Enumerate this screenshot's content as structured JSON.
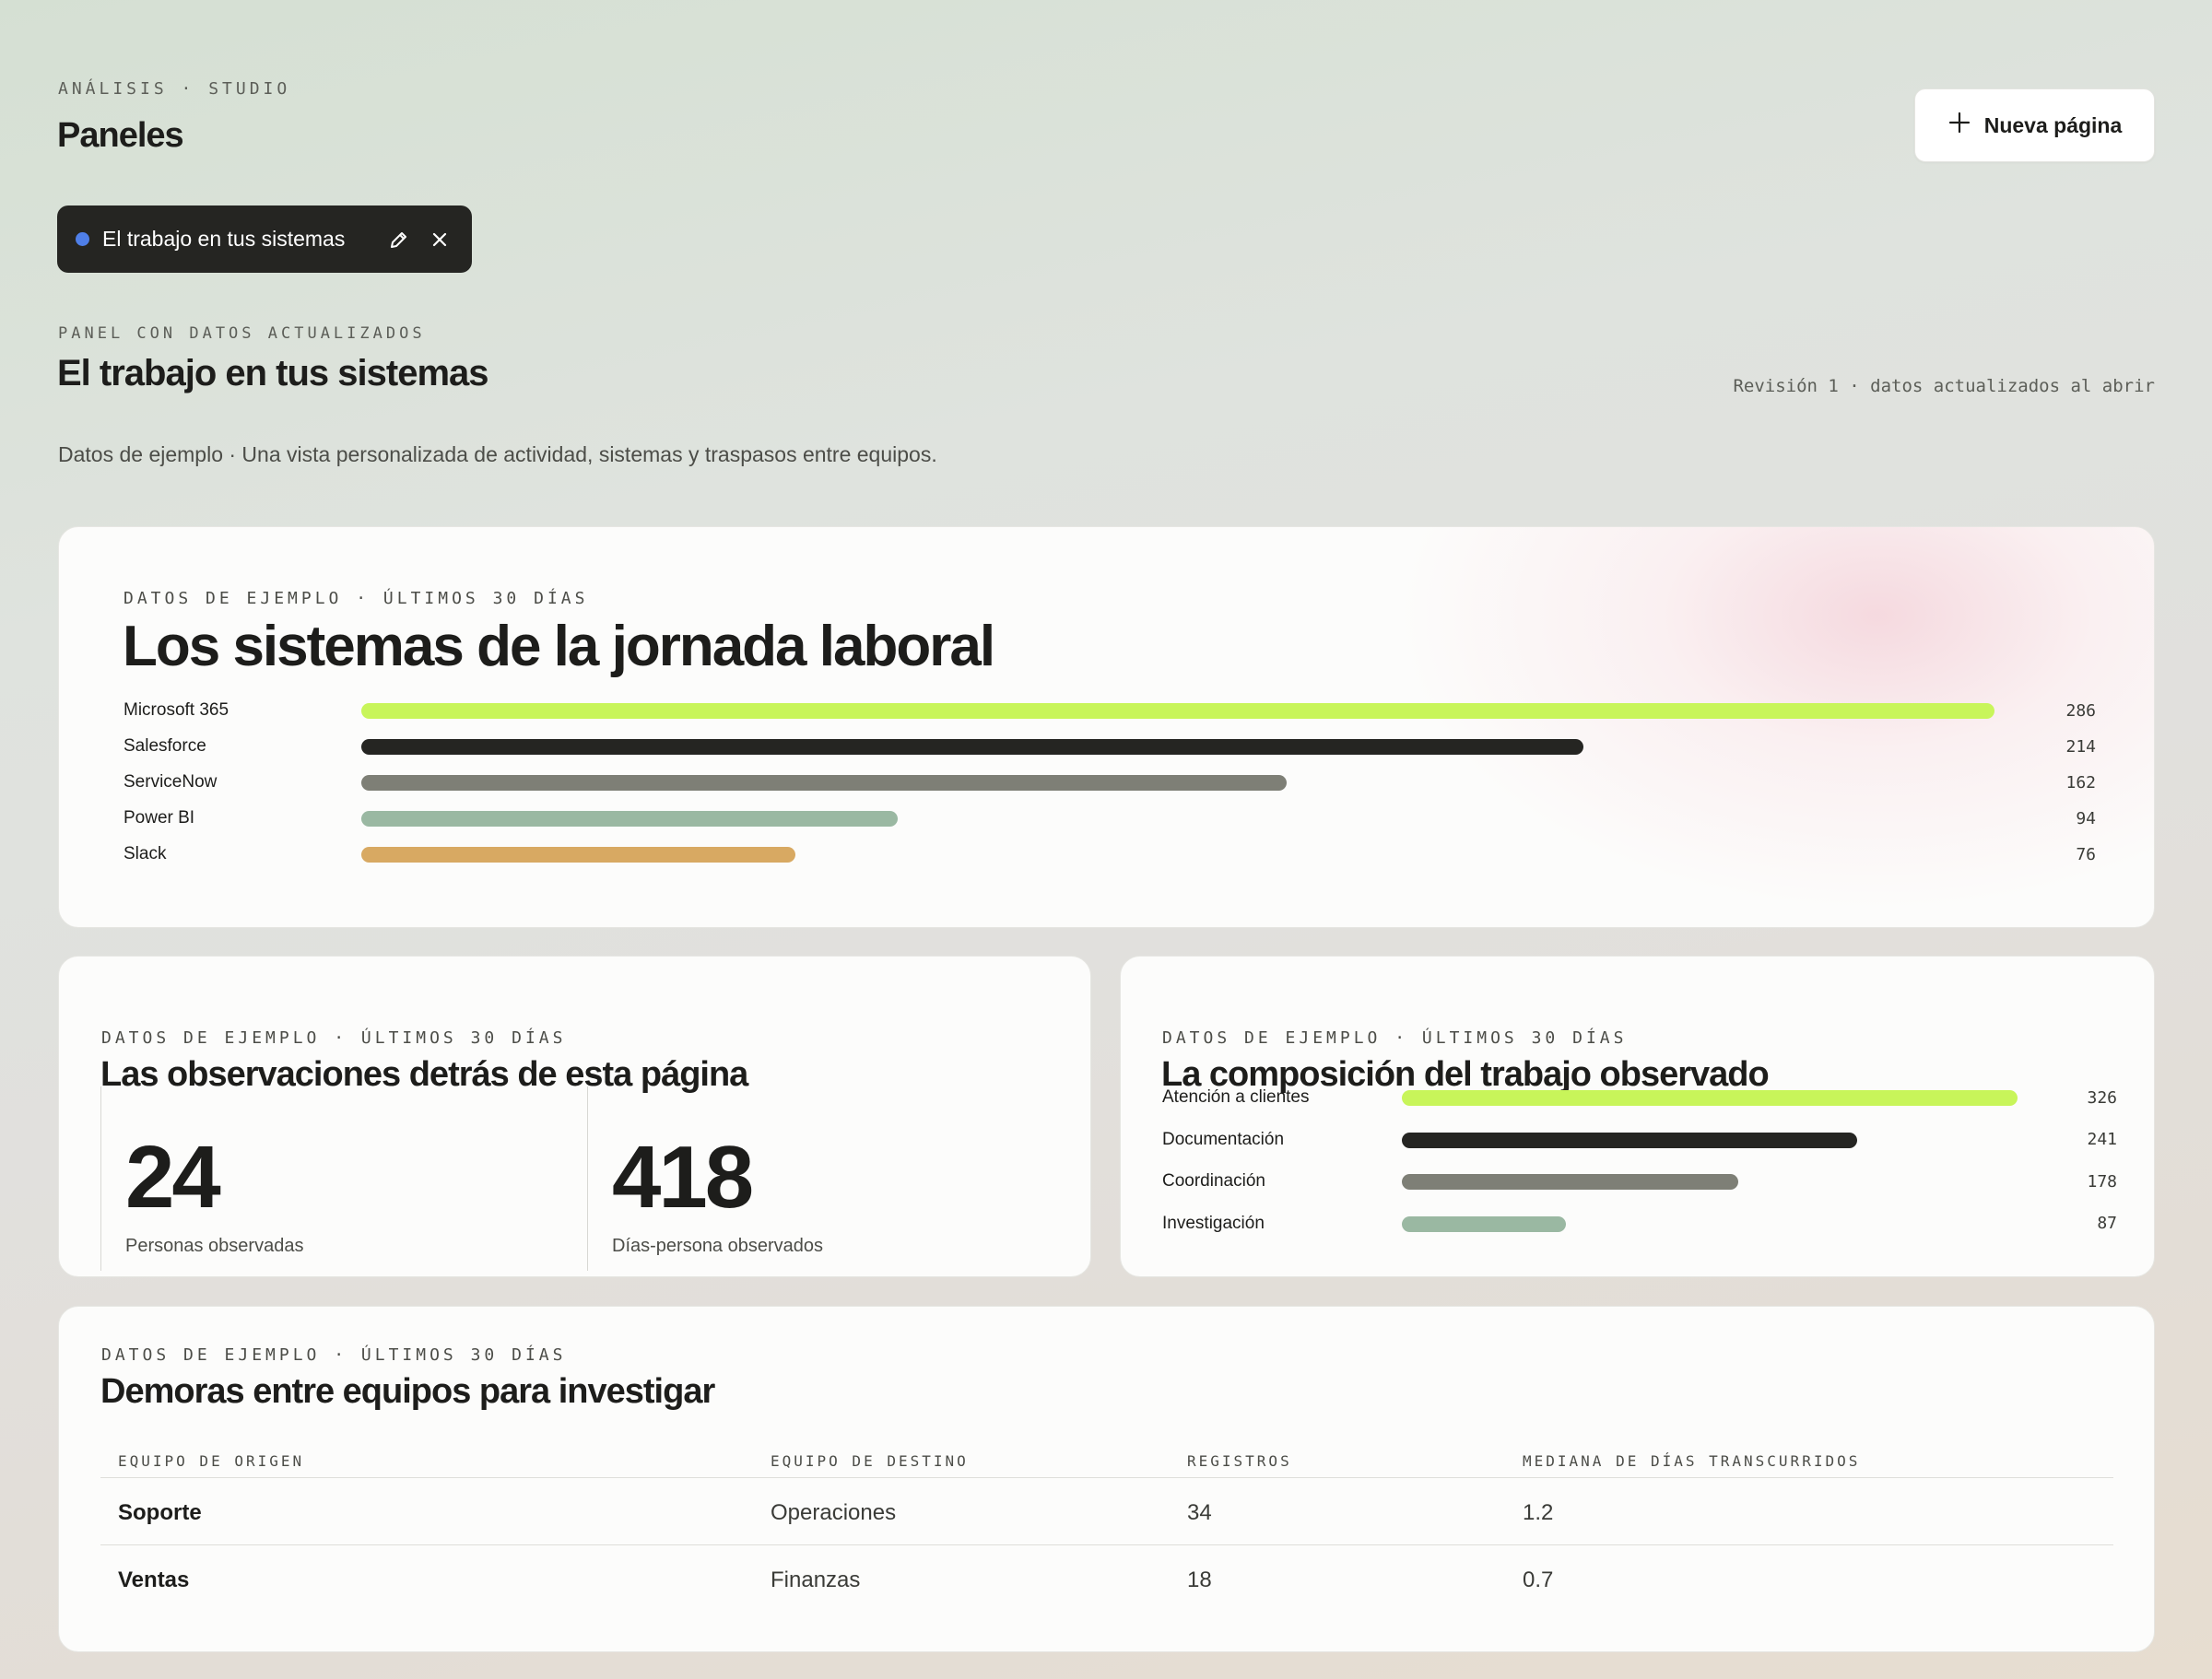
{
  "header": {
    "eyebrow": "ANÁLISIS · STUDIO",
    "title": "Paneles",
    "new_page_label": "Nueva página"
  },
  "chip": {
    "label": "El trabajo en tus sistemas",
    "dot_color": "#4f7fe8",
    "icons": [
      "pencil-icon",
      "close-icon"
    ]
  },
  "panel": {
    "eyebrow": "PANEL CON DATOS ACTUALIZADOS",
    "title": "El trabajo en tus sistemas",
    "revision": "Revisión 1 · datos actualizados al abrir",
    "subtitle": "Datos de ejemplo · Una vista personalizada de actividad, sistemas y traspasos entre equipos."
  },
  "systems": {
    "eyebrow": "DATOS DE EJEMPLO · ÚLTIMOS 30 DÍAS",
    "title": "Los sistemas de la jornada laboral",
    "items": [
      {
        "label": "Microsoft 365",
        "value": 286,
        "color": "#c8f55a"
      },
      {
        "label": "Salesforce",
        "value": 214,
        "color": "#252522"
      },
      {
        "label": "ServiceNow",
        "value": 162,
        "color": "#7e7f76"
      },
      {
        "label": "Power BI",
        "value": 94,
        "color": "#9ab8a2"
      },
      {
        "label": "Slack",
        "value": 76,
        "color": "#d8a962"
      }
    ]
  },
  "observations": {
    "eyebrow": "DATOS DE EJEMPLO · ÚLTIMOS 30 DÍAS",
    "title": "Las observaciones detrás de esta página",
    "stats": [
      {
        "value": "24",
        "label": "Personas observadas"
      },
      {
        "value": "418",
        "label": "Días-persona observados"
      }
    ]
  },
  "composition": {
    "eyebrow": "DATOS DE EJEMPLO · ÚLTIMOS 30 DÍAS",
    "title": "La composición del trabajo observado",
    "items": [
      {
        "label": "Atención a clientes",
        "value": 326,
        "color": "#c8f55a"
      },
      {
        "label": "Documentación",
        "value": 241,
        "color": "#252522"
      },
      {
        "label": "Coordinación",
        "value": 178,
        "color": "#7e7f76"
      },
      {
        "label": "Investigación",
        "value": 87,
        "color": "#9ab8a2"
      }
    ]
  },
  "delays": {
    "eyebrow": "DATOS DE EJEMPLO · ÚLTIMOS 30 DÍAS",
    "title": "Demoras entre equipos para investigar",
    "columns": [
      "EQUIPO DE ORIGEN",
      "EQUIPO DE DESTINO",
      "REGISTROS",
      "MEDIANA DE DÍAS TRANSCURRIDOS"
    ],
    "rows": [
      [
        "Soporte",
        "Operaciones",
        "34",
        "1.2"
      ],
      [
        "Ventas",
        "Finanzas",
        "18",
        "0.7"
      ]
    ]
  },
  "chart_data": [
    {
      "type": "bar",
      "title": "Los sistemas de la jornada laboral",
      "categories": [
        "Microsoft 365",
        "Salesforce",
        "ServiceNow",
        "Power BI",
        "Slack"
      ],
      "values": [
        286,
        214,
        162,
        94,
        76
      ]
    },
    {
      "type": "bar",
      "title": "La composición del trabajo observado",
      "categories": [
        "Atención a clientes",
        "Documentación",
        "Coordinación",
        "Investigación"
      ],
      "values": [
        326,
        241,
        178,
        87
      ]
    }
  ]
}
